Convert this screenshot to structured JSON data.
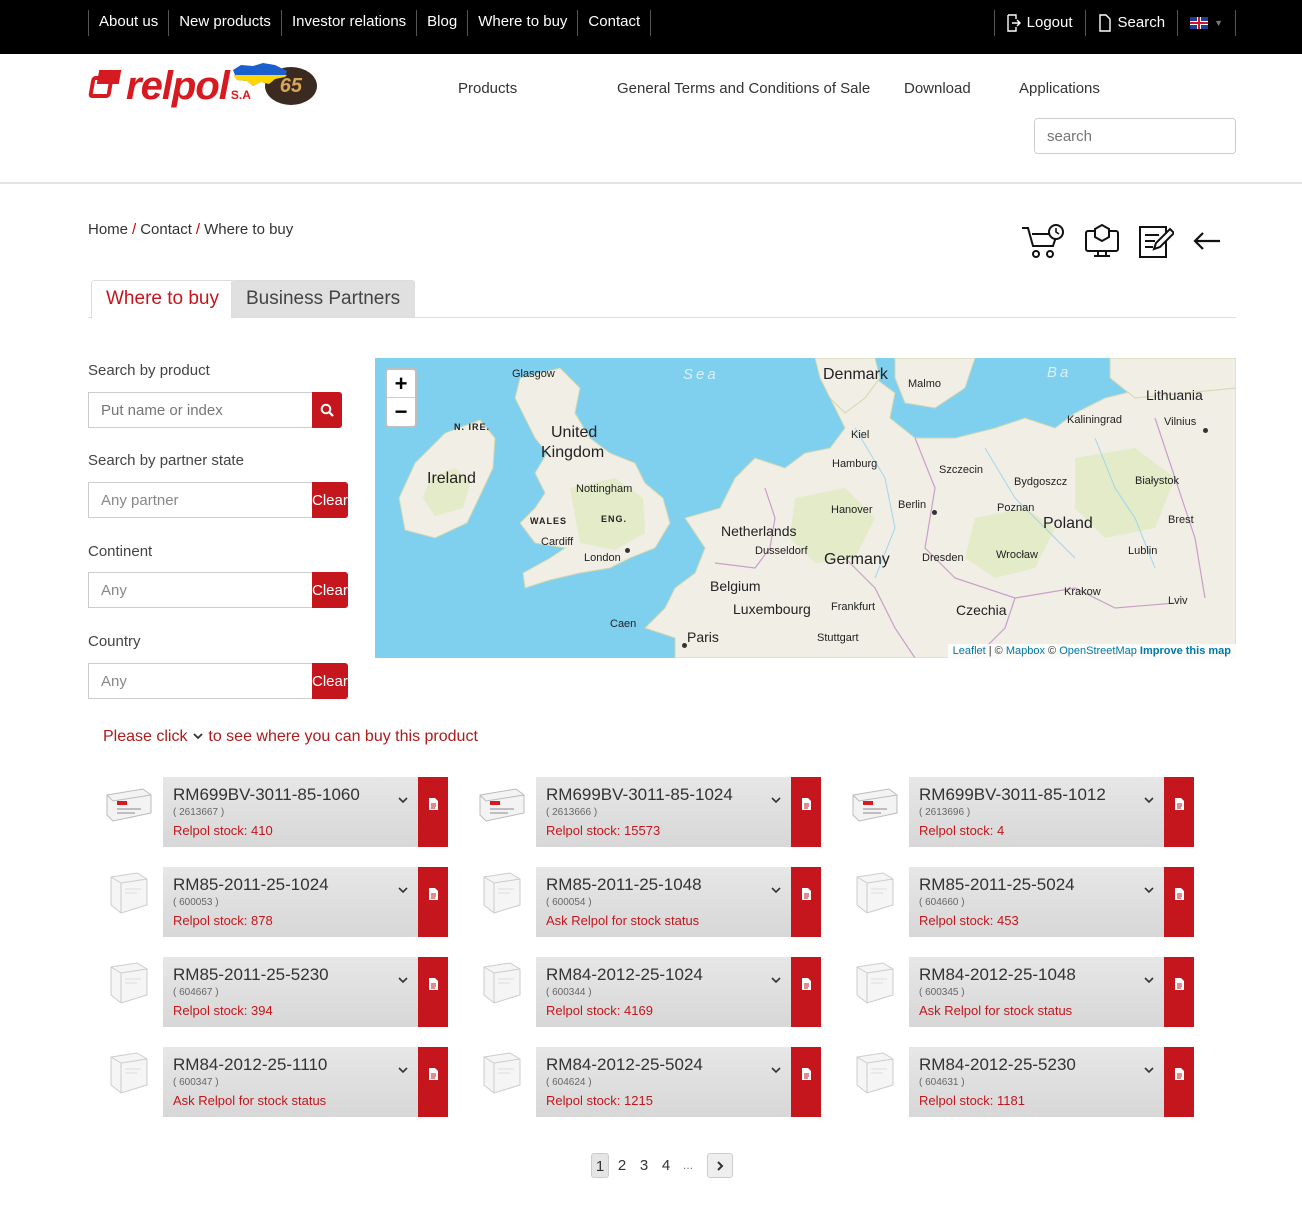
{
  "topnav": {
    "items": [
      "About us",
      "New products",
      "Investor relations",
      "Blog",
      "Where to buy",
      "Contact"
    ],
    "logout": "Logout",
    "search": "Search"
  },
  "logo": {
    "text": "relpol",
    "suffix": "S.A",
    "anniversary": "65"
  },
  "mainnav": [
    "Products",
    "General Terms and Conditions of Sale",
    "Download",
    "Applications"
  ],
  "header_search": {
    "placeholder": "search"
  },
  "breadcrumb": [
    "Home",
    "Contact",
    "Where to buy"
  ],
  "tabs": [
    "Where to buy",
    "Business Partners"
  ],
  "filters": {
    "product_label": "Search by product",
    "product_placeholder": "Put name or index",
    "partner_label": "Search by partner state",
    "partner_value": "Any partner",
    "continent_label": "Continent",
    "continent_value": "Any",
    "country_label": "Country",
    "country_value": "Any",
    "clear": "Clear"
  },
  "map": {
    "zoom_in": "+",
    "zoom_out": "−",
    "attribution": {
      "leaflet": "Leaflet",
      "mapbox": "Mapbox",
      "osm": "OpenStreetMap",
      "improve": "Improve this map"
    },
    "labels": {
      "sea1": "Sea",
      "sea2": "Ba",
      "denmark": "Denmark",
      "malmo": "Malmo",
      "lithuania": "Lithuania",
      "glasgow": "Glasgow",
      "nire": "N. IRE.",
      "uk1": "United",
      "uk2": "Kingdom",
      "kiel": "Kiel",
      "kaliningrad": "Kaliningrad",
      "vilnius": "Vilnius",
      "ireland": "Ireland",
      "hamburg": "Hamburg",
      "szczecin": "Szczecin",
      "bydgoszcz": "Bydgoszcz",
      "bialystok": "Białystok",
      "nottingham": "Nottingham",
      "wales": "WALES",
      "eng": "ENG.",
      "netherlands": "Netherlands",
      "hanover": "Hanover",
      "berlin": "Berlin",
      "poznan": "Poznan",
      "poland": "Poland",
      "brest": "Brest",
      "cardiff": "Cardiff",
      "london": "London",
      "dusseldorf": "Dusseldorf",
      "germany": "Germany",
      "dresden": "Dresden",
      "wroclaw": "Wrocław",
      "lublin": "Lublin",
      "belgium": "Belgium",
      "luxembourg": "Luxembourg",
      "frankfurt": "Frankfurt",
      "krakow": "Krakow",
      "czechia": "Czechia",
      "lviv": "Lviv",
      "caen": "Caen",
      "paris": "Paris",
      "stuttgart": "Stuttgart"
    }
  },
  "hint": {
    "before": "Please click",
    "after": "to see where you can buy this product"
  },
  "products": [
    {
      "name": "RM699BV-3011-85-1060",
      "code": "( 2613667 )",
      "stock": "Relpol stock: 410",
      "type": "slim"
    },
    {
      "name": "RM699BV-3011-85-1024",
      "code": "( 2613666 )",
      "stock": "Relpol stock: 15573",
      "type": "slim"
    },
    {
      "name": "RM699BV-3011-85-1012",
      "code": "( 2613696 )",
      "stock": "Relpol stock: 4",
      "type": "slim"
    },
    {
      "name": "RM85-2011-25-1024",
      "code": "( 600053 )",
      "stock": "Relpol stock: 878",
      "type": "box"
    },
    {
      "name": "RM85-2011-25-1048",
      "code": "( 600054 )",
      "stock": "Ask Relpol for stock status",
      "type": "box"
    },
    {
      "name": "RM85-2011-25-5024",
      "code": "( 604660 )",
      "stock": "Relpol stock: 453",
      "type": "box"
    },
    {
      "name": "RM85-2011-25-5230",
      "code": "( 604667 )",
      "stock": "Relpol stock: 394",
      "type": "box"
    },
    {
      "name": "RM84-2012-25-1024",
      "code": "( 600344 )",
      "stock": "Relpol stock: 4169",
      "type": "box"
    },
    {
      "name": "RM84-2012-25-1048",
      "code": "( 600345 )",
      "stock": "Ask Relpol for stock status",
      "type": "box"
    },
    {
      "name": "RM84-2012-25-1110",
      "code": "( 600347 )",
      "stock": "Ask Relpol for stock status",
      "type": "box"
    },
    {
      "name": "RM84-2012-25-5024",
      "code": "( 604624 )",
      "stock": "Relpol stock: 1215",
      "type": "box"
    },
    {
      "name": "RM84-2012-25-5230",
      "code": "( 604631 )",
      "stock": "Relpol stock: 1181",
      "type": "box"
    }
  ],
  "pagination": {
    "pages": [
      "1",
      "2",
      "3",
      "4"
    ],
    "ellipsis": "...",
    "current": "1"
  },
  "colors": {
    "brand_red": "#c4161c",
    "topbar": "#000000",
    "sea": "#7fcfee",
    "land": "#f0eee5"
  },
  "icons": {
    "cart": "cart-icon",
    "catalog": "catalog-icon",
    "edit": "edit-form-icon",
    "back": "arrow-left-icon",
    "logout": "logout-icon",
    "search": "search-icon",
    "flag": "uk-flag-icon",
    "pdf": "pdf-icon",
    "chevron": "chevron-down-icon"
  }
}
